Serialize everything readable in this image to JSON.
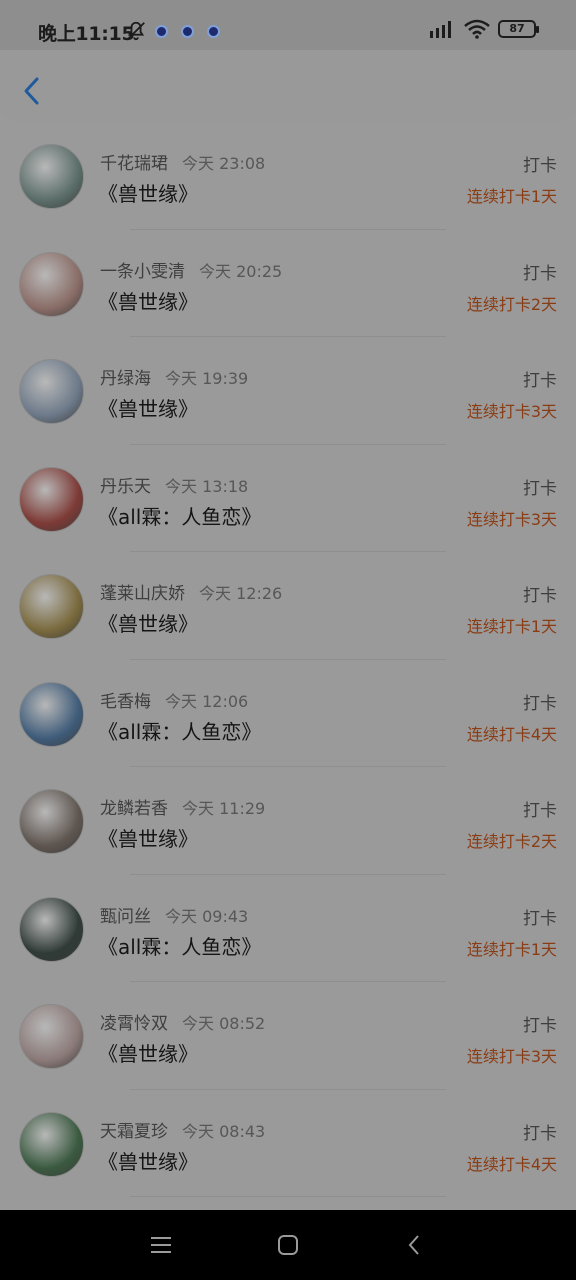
{
  "status_bar": {
    "time": "晚上11:15",
    "battery": "87"
  },
  "items": [
    {
      "name": "千花瑞珺",
      "time": "今天 23:08",
      "book": "《兽世缘》",
      "action": "打卡",
      "streak": "连续打卡1天",
      "avatar_color": "#5b6e6a"
    },
    {
      "name": "一条小雯清",
      "time": "今天 20:25",
      "book": "《兽世缘》",
      "action": "打卡",
      "streak": "连续打卡2天",
      "avatar_color": "#8a6d67"
    },
    {
      "name": "丹绿海",
      "time": "今天 19:39",
      "book": "《兽世缘》",
      "action": "打卡",
      "streak": "连续打卡3天",
      "avatar_color": "#6d7a8a"
    },
    {
      "name": "丹乐天",
      "time": "今天 13:18",
      "book": "《all霖：人鱼恋》",
      "action": "打卡",
      "streak": "连续打卡3天",
      "avatar_color": "#7d3a35"
    },
    {
      "name": "蓬莱山庆娇",
      "time": "今天 12:26",
      "book": "《兽世缘》",
      "action": "打卡",
      "streak": "连续打卡1天",
      "avatar_color": "#7a6a3d"
    },
    {
      "name": "毛香梅",
      "time": "今天 12:06",
      "book": "《all霖：人鱼恋》",
      "action": "打卡",
      "streak": "连续打卡4天",
      "avatar_color": "#3f5c7a"
    },
    {
      "name": "龙鳞若香",
      "time": "今天 11:29",
      "book": "《兽世缘》",
      "action": "打卡",
      "streak": "连续打卡2天",
      "avatar_color": "#5f5650"
    },
    {
      "name": "甄问丝",
      "time": "今天 09:43",
      "book": "《all霖：人鱼恋》",
      "action": "打卡",
      "streak": "连续打卡1天",
      "avatar_color": "#2f3a36"
    },
    {
      "name": "凌霄怜双",
      "time": "今天 08:52",
      "book": "《兽世缘》",
      "action": "打卡",
      "streak": "连续打卡3天",
      "avatar_color": "#8a7a78"
    },
    {
      "name": "天霜夏珍",
      "time": "今天 08:43",
      "book": "《兽世缘》",
      "action": "打卡",
      "streak": "连续打卡4天",
      "avatar_color": "#3a5a40"
    }
  ]
}
